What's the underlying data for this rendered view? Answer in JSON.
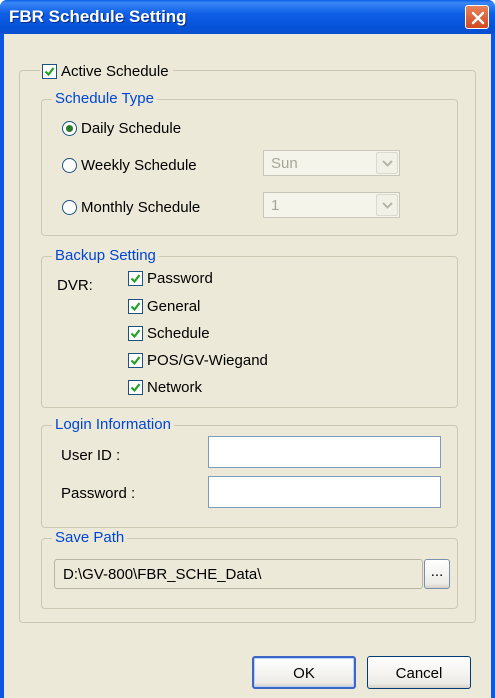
{
  "window": {
    "title": "FBR Schedule Setting"
  },
  "active_schedule": {
    "label": "Active Schedule",
    "checked": true
  },
  "schedule_type": {
    "legend": "Schedule Type",
    "options": [
      {
        "label": "Daily Schedule",
        "selected": true
      },
      {
        "label": "Weekly Schedule",
        "selected": false,
        "combo_value": "Sun"
      },
      {
        "label": "Monthly Schedule",
        "selected": false,
        "combo_value": "1"
      }
    ]
  },
  "backup_setting": {
    "legend": "Backup Setting",
    "dvr_label": "DVR:",
    "items": [
      {
        "label": "Password",
        "checked": true
      },
      {
        "label": "General",
        "checked": true
      },
      {
        "label": "Schedule",
        "checked": true
      },
      {
        "label": "POS/GV-Wiegand",
        "checked": true
      },
      {
        "label": "Network",
        "checked": true
      }
    ]
  },
  "login_information": {
    "legend": "Login Information",
    "user_id_label": "User ID :",
    "user_id_value": "",
    "password_label": "Password :",
    "password_value": ""
  },
  "save_path": {
    "legend": "Save Path",
    "value": "D:\\GV-800\\FBR_SCHE_Data\\",
    "browse_label": "..."
  },
  "buttons": {
    "ok": "OK",
    "cancel": "Cancel"
  },
  "colors": {
    "title_bar": "#0552d9",
    "legend_text": "#0046d5",
    "dialog_bg": "#ece9d8"
  }
}
